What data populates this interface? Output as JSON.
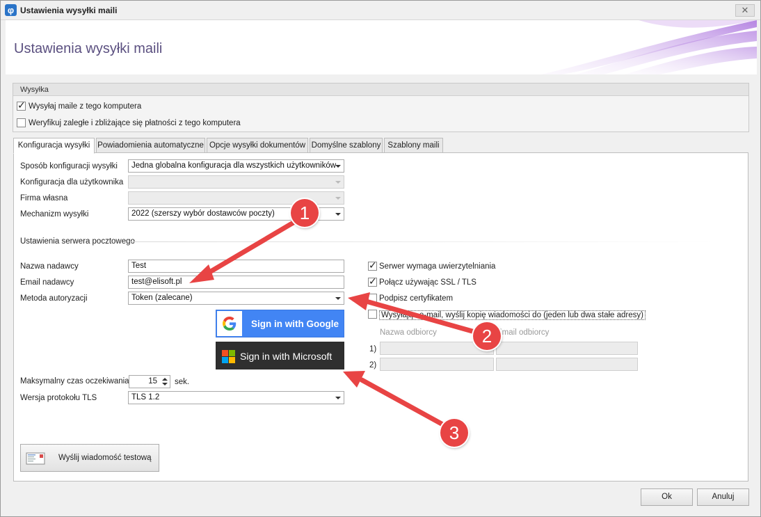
{
  "window": {
    "title": "Ustawienia wysyłki maili",
    "header_title": "Ustawienia wysyłki maili",
    "close_glyph": "✕"
  },
  "wysylka": {
    "group_title": "Wysyłka",
    "send_from_computer": {
      "label": "Wysyłaj maile z tego komputera",
      "checked": true
    },
    "verify_overdue": {
      "label": "Weryfikuj zaległe i zbliżające się płatności z tego komputera",
      "checked": false
    }
  },
  "tabs": [
    {
      "label": "Konfiguracja wysyłki",
      "active": true
    },
    {
      "label": "Powiadomienia automatyczne",
      "active": false
    },
    {
      "label": "Opcje wysyłki dokumentów",
      "active": false
    },
    {
      "label": "Domyślne szablony",
      "active": false
    },
    {
      "label": "Szablony maili",
      "active": false
    }
  ],
  "config": {
    "method_label": "Sposób konfiguracji wysyłki",
    "method_value": "Jedna globalna konfiguracja dla wszystkich użytkowników",
    "user_config_label": "Konfiguracja dla użytkownika",
    "user_config_value": "",
    "company_label": "Firma własna",
    "company_value": "",
    "mechanism_label": "Mechanizm wysyłki",
    "mechanism_value": "2022 (szerszy wybór dostawców poczty)"
  },
  "server": {
    "section_title": "Ustawienia serwera pocztowego",
    "sender_name_label": "Nazwa nadawcy",
    "sender_name_value": "Test",
    "sender_email_label": "Email nadawcy",
    "sender_email_value": "test@elisoft.pl",
    "auth_method_label": "Metoda autoryzacji",
    "auth_method_value": "Token (zalecane)",
    "google_button": "Sign in with Google",
    "microsoft_button": "Sign in with Microsoft",
    "timeout_label": "Maksymalny czas oczekiwania",
    "timeout_value": "15",
    "timeout_unit": "sek.",
    "tls_label": "Wersja protokołu TLS",
    "tls_value": "TLS 1.2"
  },
  "options": {
    "requires_auth": {
      "label": "Serwer wymaga uwierzytelniania",
      "checked": true
    },
    "use_ssl": {
      "label": "Połącz używając SSL / TLS",
      "checked": true
    },
    "sign_cert": {
      "label": "Podpisz certyfikatem",
      "checked": false
    },
    "copy_email": {
      "label": "Wysyłając e-mail, wyślij kopię wiadomości do (jeden lub dwa stałe adresy)",
      "checked": false
    },
    "recipient_name_header": "Nazwa odbiorcy",
    "recipient_email_header": "Email odbiorcy",
    "rows": [
      {
        "num": "1)",
        "name": "",
        "email": ""
      },
      {
        "num": "2)",
        "name": "",
        "email": ""
      }
    ]
  },
  "test_button": "Wyślij wiadomość testową",
  "footer": {
    "ok": "Ok",
    "cancel": "Anuluj"
  },
  "callouts": [
    "1",
    "2",
    "3"
  ],
  "colors": {
    "callout": "#e84444",
    "google_blue": "#4285f4",
    "microsoft_dark": "#2f2f2f",
    "header_title": "#5b5080"
  }
}
